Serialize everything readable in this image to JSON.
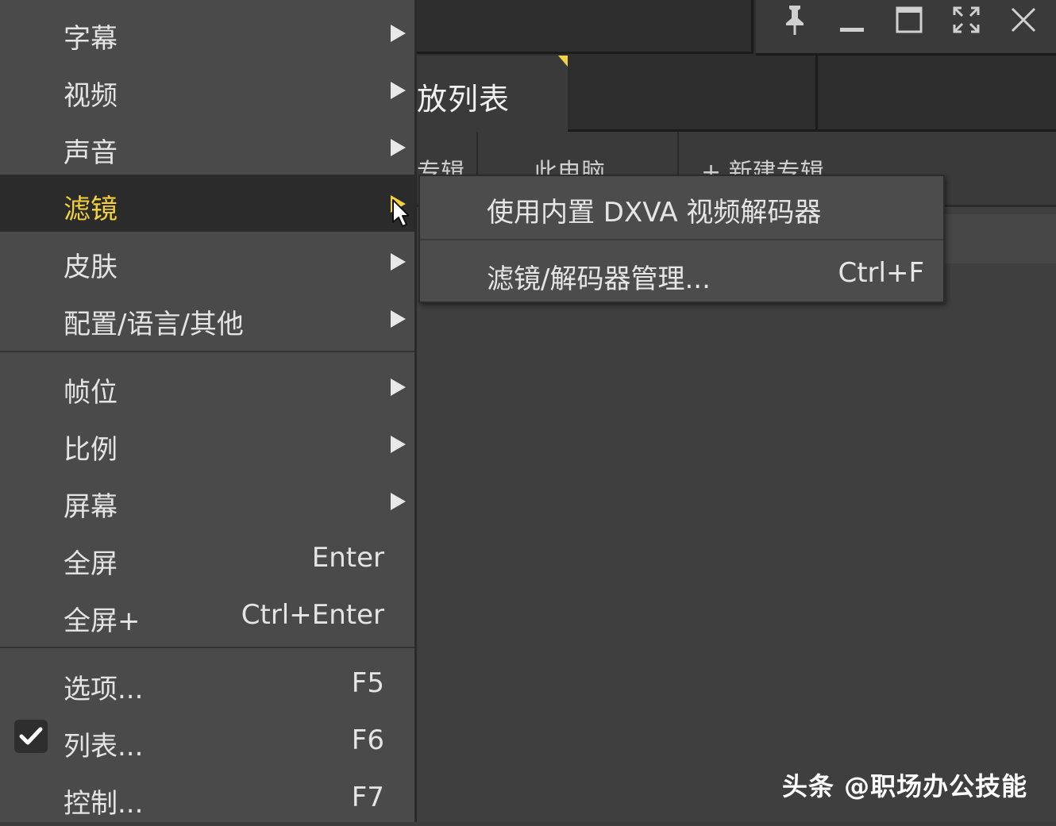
{
  "window": {
    "playlist_tab": "放列表",
    "subtabs": [
      "专辑",
      "此电脑",
      "+ 新建专辑"
    ],
    "controls": [
      "pin-icon",
      "minimize-icon",
      "maximize-icon",
      "fullscreen-icon",
      "close-icon"
    ]
  },
  "menu": {
    "items": [
      {
        "label": "字幕",
        "has_submenu": true
      },
      {
        "label": "视频",
        "has_submenu": true
      },
      {
        "label": "声音",
        "has_submenu": true
      },
      {
        "label": "滤镜",
        "has_submenu": true,
        "active": true
      },
      {
        "label": "皮肤",
        "has_submenu": true
      },
      {
        "label": "配置/语言/其他",
        "has_submenu": true
      },
      {
        "label": "帧位",
        "has_submenu": true
      },
      {
        "label": "比例",
        "has_submenu": true
      },
      {
        "label": "屏幕",
        "has_submenu": true
      },
      {
        "label": "全屏",
        "shortcut": "Enter"
      },
      {
        "label": "全屏+",
        "shortcut": "Ctrl+Enter"
      },
      {
        "label": "选项...",
        "shortcut": "F5"
      },
      {
        "label": "列表...",
        "shortcut": "F6",
        "checked": true
      },
      {
        "label": "控制...",
        "shortcut": "F7"
      }
    ]
  },
  "submenu": {
    "items": [
      {
        "label": "使用内置 DXVA 视频解码器"
      },
      {
        "label": "滤镜/解码器管理...",
        "shortcut": "Ctrl+F"
      }
    ]
  },
  "watermark": "头条 @职场办公技能",
  "colors": {
    "accent": "#f4d23e",
    "menu_bg": "#4a4a4a",
    "active_bg": "#2b2b2b",
    "window_bg": "#3f3f3f"
  }
}
